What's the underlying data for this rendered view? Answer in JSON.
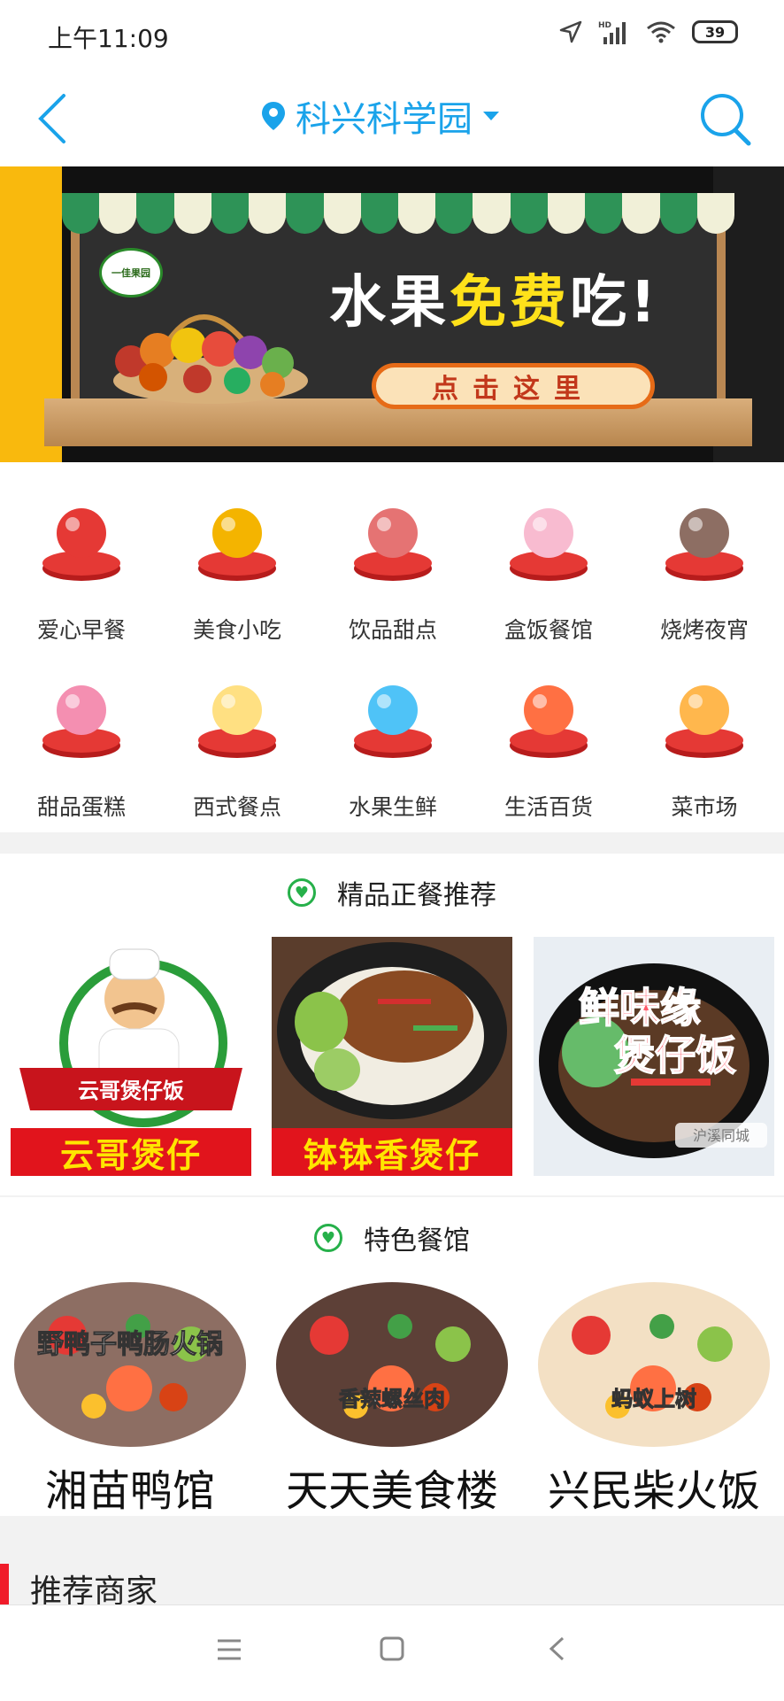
{
  "status_bar": {
    "time": "上午11:09",
    "network": "HD",
    "battery": "39"
  },
  "header": {
    "location": "科兴科学园"
  },
  "banner": {
    "title_part1": "水果",
    "title_highlight": "免费",
    "title_part2": "吃!",
    "button": "点击这里",
    "logo_text": "一佳果园"
  },
  "categories": [
    {
      "label": "爱心早餐",
      "icon": "breakfast-icon"
    },
    {
      "label": "美食小吃",
      "icon": "snack-icon"
    },
    {
      "label": "饮品甜点",
      "icon": "drink-icon"
    },
    {
      "label": "盒饭餐馆",
      "icon": "boxed-meal-icon"
    },
    {
      "label": "烧烤夜宵",
      "icon": "bbq-icon"
    },
    {
      "label": "甜品蛋糕",
      "icon": "cake-icon"
    },
    {
      "label": "西式餐点",
      "icon": "western-food-icon"
    },
    {
      "label": "水果生鲜",
      "icon": "fruit-icon"
    },
    {
      "label": "生活百货",
      "icon": "groceries-icon"
    },
    {
      "label": "菜市场",
      "icon": "market-icon"
    }
  ],
  "featured": {
    "title": "精品正餐推荐",
    "items": [
      {
        "caption": "云哥煲仔",
        "sign": "云哥煲仔饭"
      },
      {
        "caption": "钵钵香煲仔"
      },
      {
        "overlay": "鲜味缘煲仔饭",
        "watermark": "沪溪同城"
      }
    ]
  },
  "specialty": {
    "title": "特色餐馆",
    "items": [
      {
        "name": "湘苗鸭馆",
        "dish": "野鸭子鸭肠火锅"
      },
      {
        "name": "天天美食楼",
        "dish": "香辣螺丝肉"
      },
      {
        "name": "兴民柴火饭",
        "dish": "蚂蚁上树"
      }
    ]
  },
  "recommend": {
    "title": "推荐商家"
  },
  "colors": {
    "accent": "#1aa3ea",
    "red": "#e1141c",
    "green": "#26b04a"
  }
}
